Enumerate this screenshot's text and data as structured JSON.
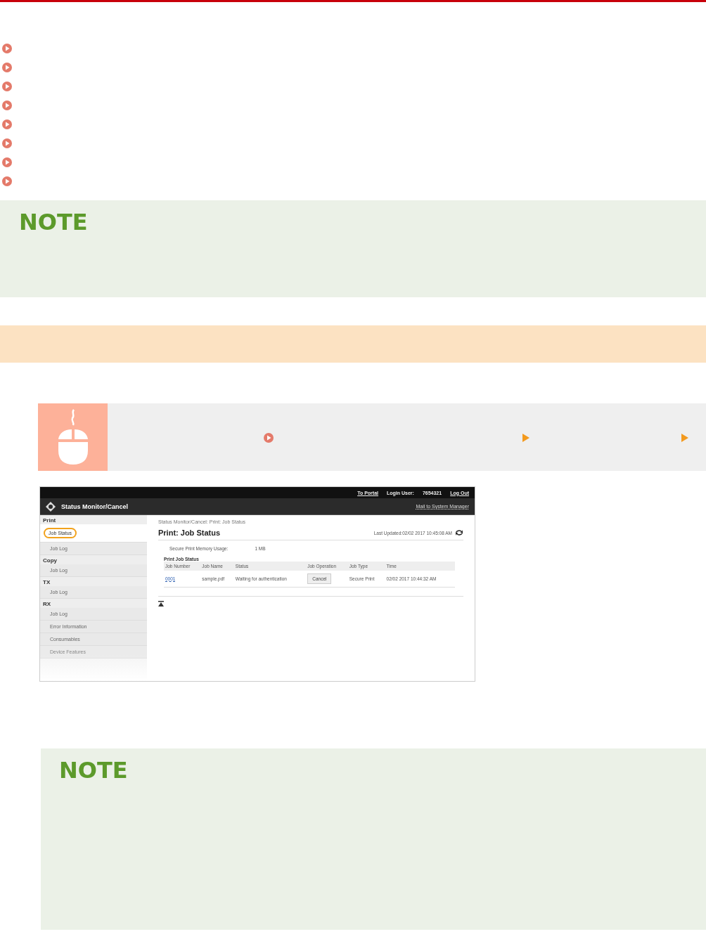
{
  "links": [
    {
      "kind": "link"
    },
    {
      "kind": "link"
    },
    {
      "kind": "link"
    },
    {
      "kind": "link"
    },
    {
      "kind": "link"
    },
    {
      "kind": "link"
    },
    {
      "kind": "link"
    },
    {
      "kind": "link"
    }
  ],
  "notes": [
    {
      "title": "NOTE"
    },
    {
      "title": "NOTE"
    }
  ],
  "step": {
    "markers": [
      {
        "kind": "link"
      },
      {
        "kind": "arrow"
      },
      {
        "kind": "arrow"
      }
    ]
  },
  "ui": {
    "top_links": [
      {
        "text": "To Portal",
        "kind": "link"
      },
      {
        "text": "Login User:",
        "kind": "label"
      },
      {
        "text": "7654321",
        "kind": "label"
      },
      {
        "text": "Log Out",
        "kind": "link"
      }
    ],
    "title": "Status Monitor/Cancel",
    "mail": "Mail to System Manager",
    "sidebar": [
      {
        "text": "Print",
        "kind": "header"
      },
      {
        "text": "Job Status",
        "kind": "item",
        "selected": true
      },
      {
        "text": "Job Log",
        "kind": "item",
        "selected": false
      },
      {
        "text": "Copy",
        "kind": "header"
      },
      {
        "text": "Job Log",
        "kind": "item",
        "selected": false
      },
      {
        "text": "TX",
        "kind": "header"
      },
      {
        "text": "Job Log",
        "kind": "item",
        "selected": false
      },
      {
        "text": "RX",
        "kind": "header"
      },
      {
        "text": "Job Log",
        "kind": "item",
        "selected": false
      },
      {
        "text": "Error Information",
        "kind": "item",
        "selected": false
      },
      {
        "text": "Consumables",
        "kind": "item",
        "selected": false
      },
      {
        "text": "Device Features",
        "kind": "item",
        "selected": false
      }
    ],
    "breadcrumb": "Status Monitor/Cancel: Print: Job Status",
    "heading": "Print: Job Status",
    "updated": "Last Updated:02/02 2017 10:45:08 AM",
    "memory_label": "Secure Print Memory Usage:",
    "memory_value": "1 MB",
    "section": "Print Job Status",
    "table": {
      "columns": [
        "Job Number",
        "Job Name",
        "Status",
        "Job Operation",
        "Job Type",
        "Time"
      ],
      "rows": [
        {
          "number": "0001",
          "name": "sample.pdf",
          "status": "Waiting for authentication",
          "operation": "Cancel",
          "type": "Secure Print",
          "time": "02/02 2017 10:44:32 AM"
        }
      ]
    }
  }
}
